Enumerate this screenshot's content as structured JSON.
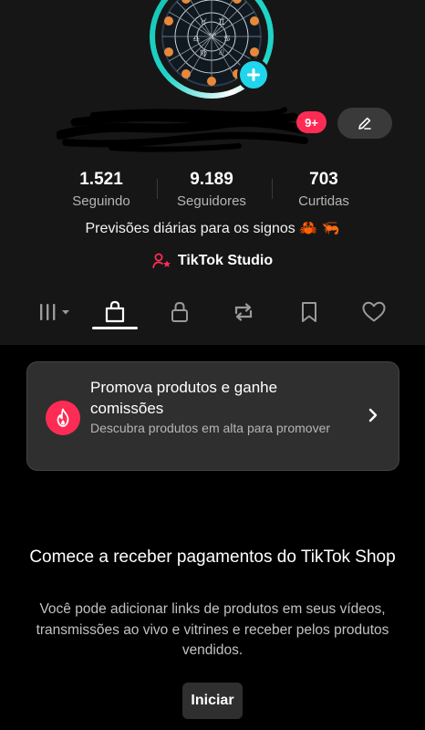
{
  "profile": {
    "notification_badge": "9+",
    "edit_icon": "pencil-icon",
    "avatar_add_icon": "plus-icon"
  },
  "stats": [
    {
      "value": "1.521",
      "label": "Seguindo"
    },
    {
      "value": "9.189",
      "label": "Seguidores"
    },
    {
      "value": "703",
      "label": "Curtidas"
    }
  ],
  "bio": "Previsões diárias para os signos 🦀 🦐",
  "studio": {
    "label": "TikTok Studio",
    "icon": "person-star-icon"
  },
  "tabs": [
    {
      "icon": "grid-dropdown-icon",
      "active": false
    },
    {
      "icon": "shopping-bag-icon",
      "active": true
    },
    {
      "icon": "lock-icon",
      "active": false
    },
    {
      "icon": "repost-icon",
      "active": false
    },
    {
      "icon": "bookmark-icon",
      "active": false
    },
    {
      "icon": "heart-icon",
      "active": false
    }
  ],
  "promo": {
    "title": "Promova produtos e ganhe comissões",
    "subtitle": "Descubra produtos em alta para promover",
    "icon": "flame-icon"
  },
  "empty_state": {
    "title": "Comece a receber pagamentos do TikTok Shop",
    "description": "Você pode adicionar links de produtos em seus vídeos, transmissões ao vivo e vitrines e receber pelos produtos vendidos.",
    "button": "Iniciar"
  },
  "colors": {
    "accent_pink": "#fe2c55",
    "accent_cyan": "#20d5ec",
    "header_bg": "#161616",
    "body_bg": "#000000",
    "card_bg": "#2f2f2f"
  }
}
